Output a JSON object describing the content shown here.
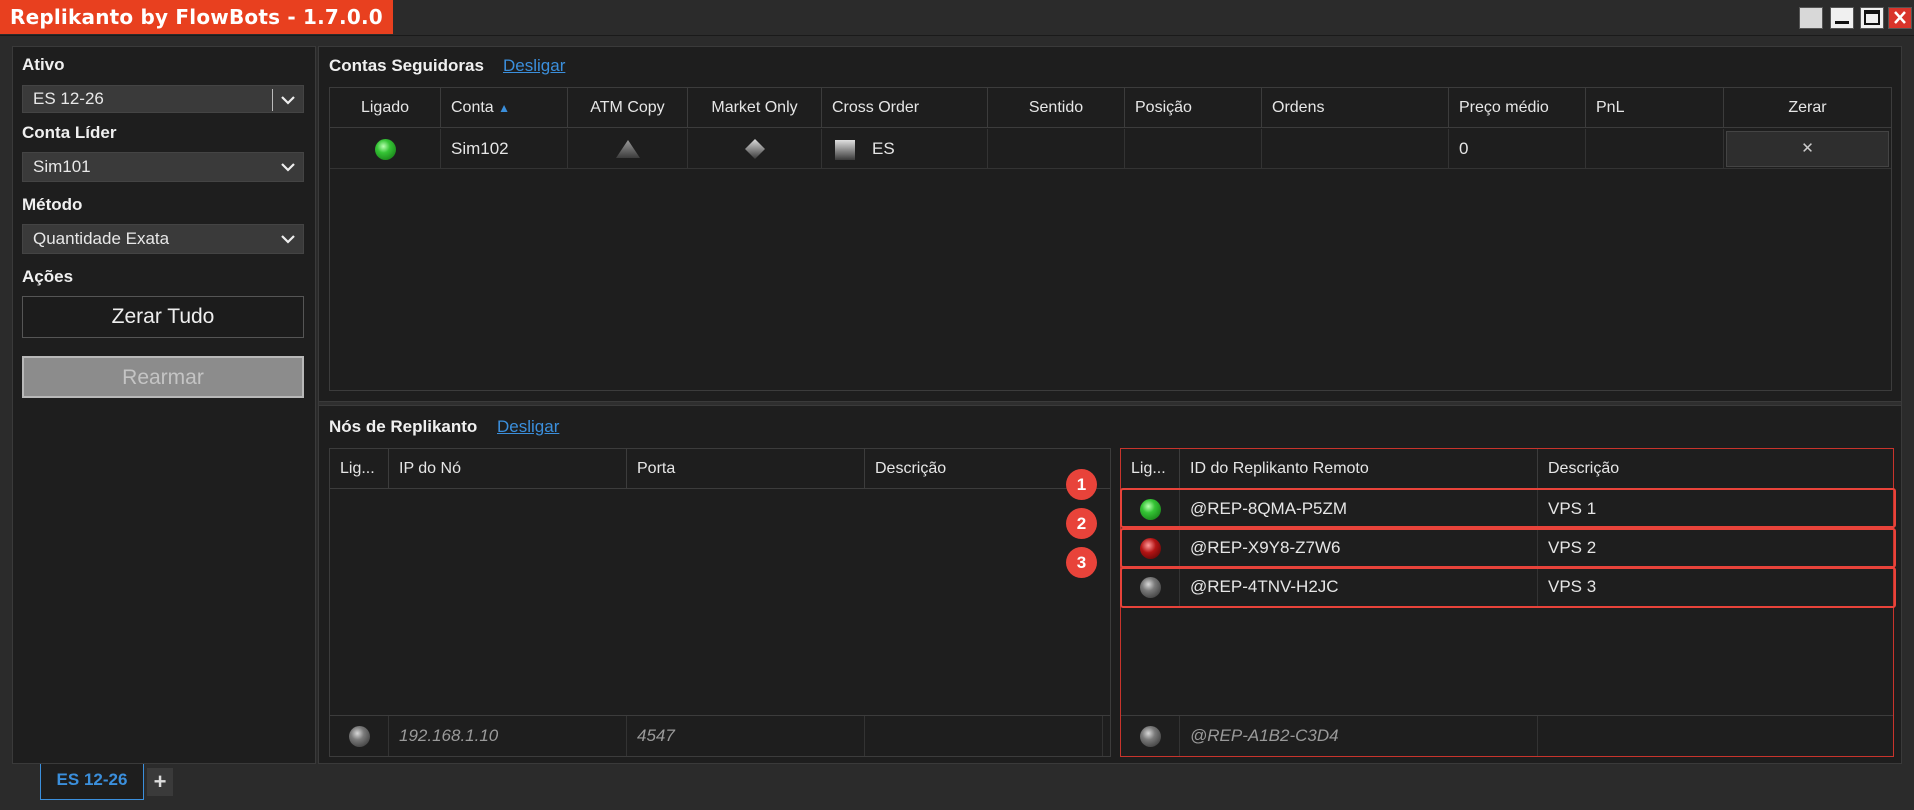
{
  "window": {
    "title": "Replikanto by FlowBots - 1.7.0.0"
  },
  "sidebar": {
    "ativo_label": "Ativo",
    "ativo_value": "ES 12-26",
    "conta_lider_label": "Conta Líder",
    "conta_lider_value": "Sim101",
    "metodo_label": "Método",
    "metodo_value": "Quantidade Exata",
    "acoes_label": "Ações",
    "zerar_tudo": "Zerar Tudo",
    "rearmar": "Rearmar"
  },
  "followers": {
    "title": "Contas Seguidoras",
    "link": "Desligar",
    "columns": [
      "Ligado",
      "Conta",
      "ATM Copy",
      "Market Only",
      "Cross Order",
      "Sentido",
      "Posição",
      "Ordens",
      "Preço médio",
      "PnL",
      "Zerar"
    ],
    "sort_arrow": "▲",
    "row": {
      "status": "green",
      "conta": "Sim102",
      "cross_order": "ES",
      "sentido": "",
      "posicao": "",
      "ordens": "",
      "preco": "0",
      "pnl": "",
      "zerar": "✕"
    }
  },
  "nodes": {
    "title": "Nós de Replikanto",
    "link": "Desligar",
    "left_columns": [
      "Lig...",
      "IP do Nó",
      "Porta",
      "Descrição"
    ],
    "left_new": {
      "ip": "192.168.1.10",
      "porta": "4547",
      "descricao": ""
    },
    "right_columns": [
      "Lig...",
      "ID do Replikanto Remoto",
      "Descrição"
    ],
    "right_rows": [
      {
        "status": "green",
        "id": "@REP-8QMA-P5ZM",
        "descricao": "VPS 1",
        "badge": "1"
      },
      {
        "status": "red",
        "id": "@REP-X9Y8-Z7W6",
        "descricao": "VPS 2",
        "badge": "2"
      },
      {
        "status": "gray",
        "id": "@REP-4TNV-H2JC",
        "descricao": "VPS 3",
        "badge": "3"
      }
    ],
    "right_new": {
      "id": "@REP-A1B2-C3D4",
      "descricao": ""
    }
  },
  "tabs": {
    "active": "ES 12-26",
    "add": "+"
  },
  "colors": {
    "accent": "#3b8fdc",
    "title_bg": "#e8401f",
    "highlight": "#e8433a"
  }
}
